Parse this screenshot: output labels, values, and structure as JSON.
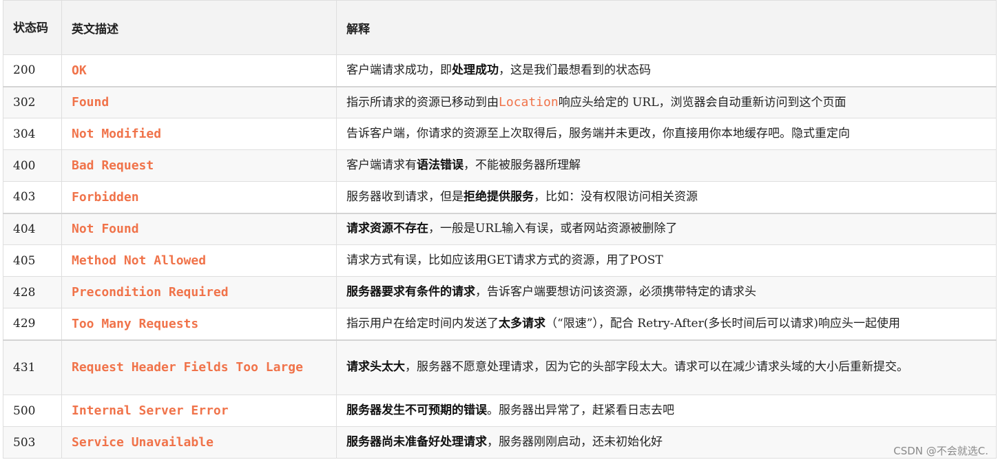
{
  "header": {
    "code": "状态码",
    "english": "英文描述",
    "explain": "解释"
  },
  "rows": [
    {
      "code": "200",
      "english": "OK",
      "parts": [
        [
          "客户端请求成功，即",
          0
        ],
        [
          "处理成功",
          1
        ],
        [
          "，这是我们最想看到的状态码",
          0
        ]
      ]
    },
    {
      "code": "302",
      "english": "Found",
      "parts": [
        [
          "指示所请求的资源已移动到由",
          0
        ],
        [
          "Location",
          2
        ],
        [
          "响应头给定的 URL，浏览器会自动重新访问到这个页面",
          0
        ]
      ]
    },
    {
      "code": "304",
      "english": "Not Modified",
      "parts": [
        [
          "告诉客户端，你请求的资源至上次取得后，服务端并未更改，你直接用你本地缓存吧。隐式重定向",
          0
        ]
      ]
    },
    {
      "code": "400",
      "english": "Bad Request",
      "parts": [
        [
          "客户端请求有",
          0
        ],
        [
          "语法错误",
          1
        ],
        [
          "，不能被服务器所理解",
          0
        ]
      ]
    },
    {
      "code": "403",
      "english": "Forbidden",
      "parts": [
        [
          "服务器收到请求，但是",
          0
        ],
        [
          "拒绝提供服务",
          1
        ],
        [
          "，比如：没有权限访问相关资源",
          0
        ]
      ]
    },
    {
      "code": "404",
      "english": "Not Found",
      "parts": [
        [
          "请求资源不存在",
          1
        ],
        [
          "，一般是URL输入有误，或者网站资源被删除了",
          0
        ]
      ]
    },
    {
      "code": "405",
      "english": "Method Not Allowed",
      "parts": [
        [
          "请求方式有误，比如应该用GET请求方式的资源，用了POST",
          0
        ]
      ]
    },
    {
      "code": "428",
      "english": "Precondition Required",
      "parts": [
        [
          "服务器要求有条件的请求",
          1
        ],
        [
          "，告诉客户端要想访问该资源，必须携带特定的请求头",
          0
        ]
      ]
    },
    {
      "code": "429",
      "english": "Too Many Requests",
      "parts": [
        [
          "指示用户在给定时间内发送了",
          0
        ],
        [
          "太多请求",
          1
        ],
        [
          "（“限速”），配合 Retry-After(多长时间后可以请求)响应头一起使用",
          0
        ]
      ]
    },
    {
      "code": "431",
      "english": "Request Header Fields Too Large",
      "parts": [
        [
          "请求头太大",
          1
        ],
        [
          "，服务器不愿意处理请求，因为它的头部字段太大。请求可以在减少请求头域的大小后重新提交。",
          0
        ]
      ]
    },
    {
      "code": "500",
      "english": "Internal Server Error",
      "parts": [
        [
          "服务器发生不可预期的错误",
          1
        ],
        [
          "。服务器出异常了，赶紧看日志去吧",
          0
        ]
      ]
    },
    {
      "code": "503",
      "english": "Service Unavailable",
      "parts": [
        [
          "服务器尚未准备好处理请求",
          1
        ],
        [
          "，服务器刚刚启动，还未初始化好",
          0
        ]
      ]
    }
  ],
  "watermark": "CSDN @不会就选C.",
  "colors": {
    "english_text": "#f0734a",
    "header_bg": "#f3f3f3",
    "row_alt_bg": "#f8f8f8",
    "border": "#dedede"
  }
}
